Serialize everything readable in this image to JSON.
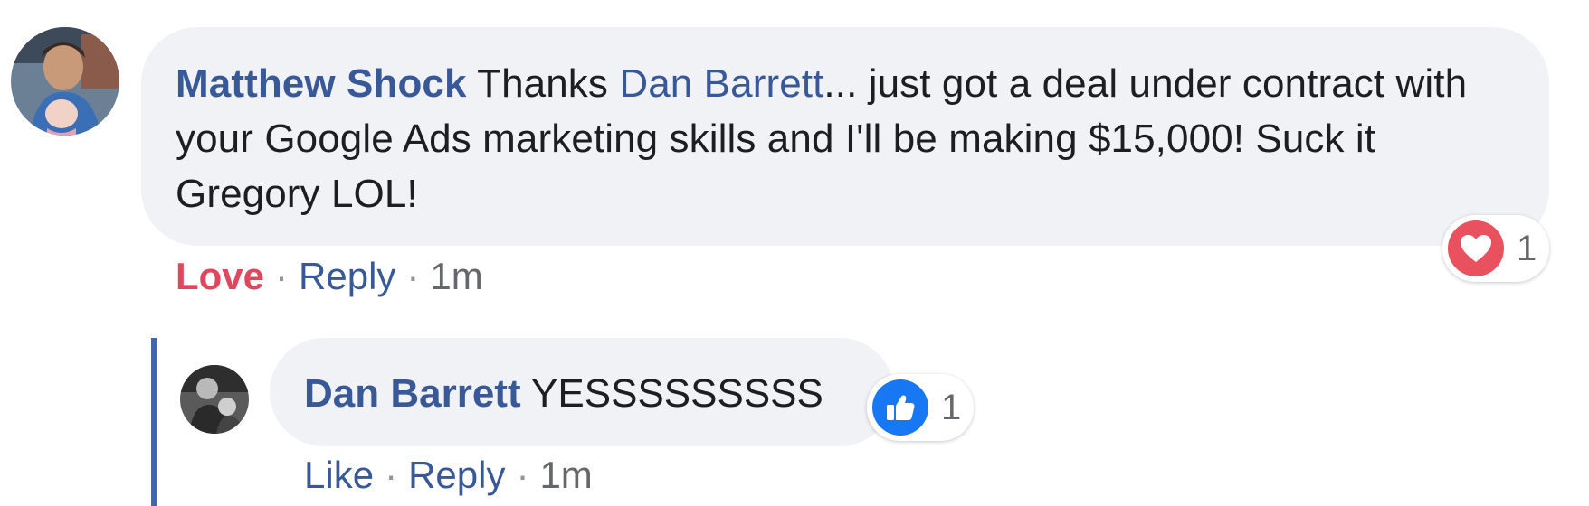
{
  "comment": {
    "author": "Matthew Shock",
    "text_before_mention": " Thanks ",
    "mention": "Dan Barrett",
    "text_after_mention": "... just got a deal under contract with your Google Ads marketing skills and I'll be making $15,000! Suck it Gregory LOL!",
    "reaction": {
      "icon": "heart-icon",
      "color": "#e9515f",
      "count": "1"
    },
    "actions": {
      "love_label": "Love",
      "separator": "·",
      "reply_label": "Reply",
      "timestamp": "1m"
    }
  },
  "reply": {
    "author": "Dan Barrett",
    "text": " YESSSSSSSSS",
    "reaction": {
      "icon": "thumbs-up-icon",
      "color": "#1877f2",
      "count": "1"
    },
    "actions": {
      "like_label": "Like",
      "separator": "·",
      "reply_label": "Reply",
      "timestamp": "1m"
    }
  },
  "colors": {
    "link": "#385898",
    "love": "#e0475f",
    "bubble": "#f0f2f5",
    "thread_line": "#4267b2"
  }
}
